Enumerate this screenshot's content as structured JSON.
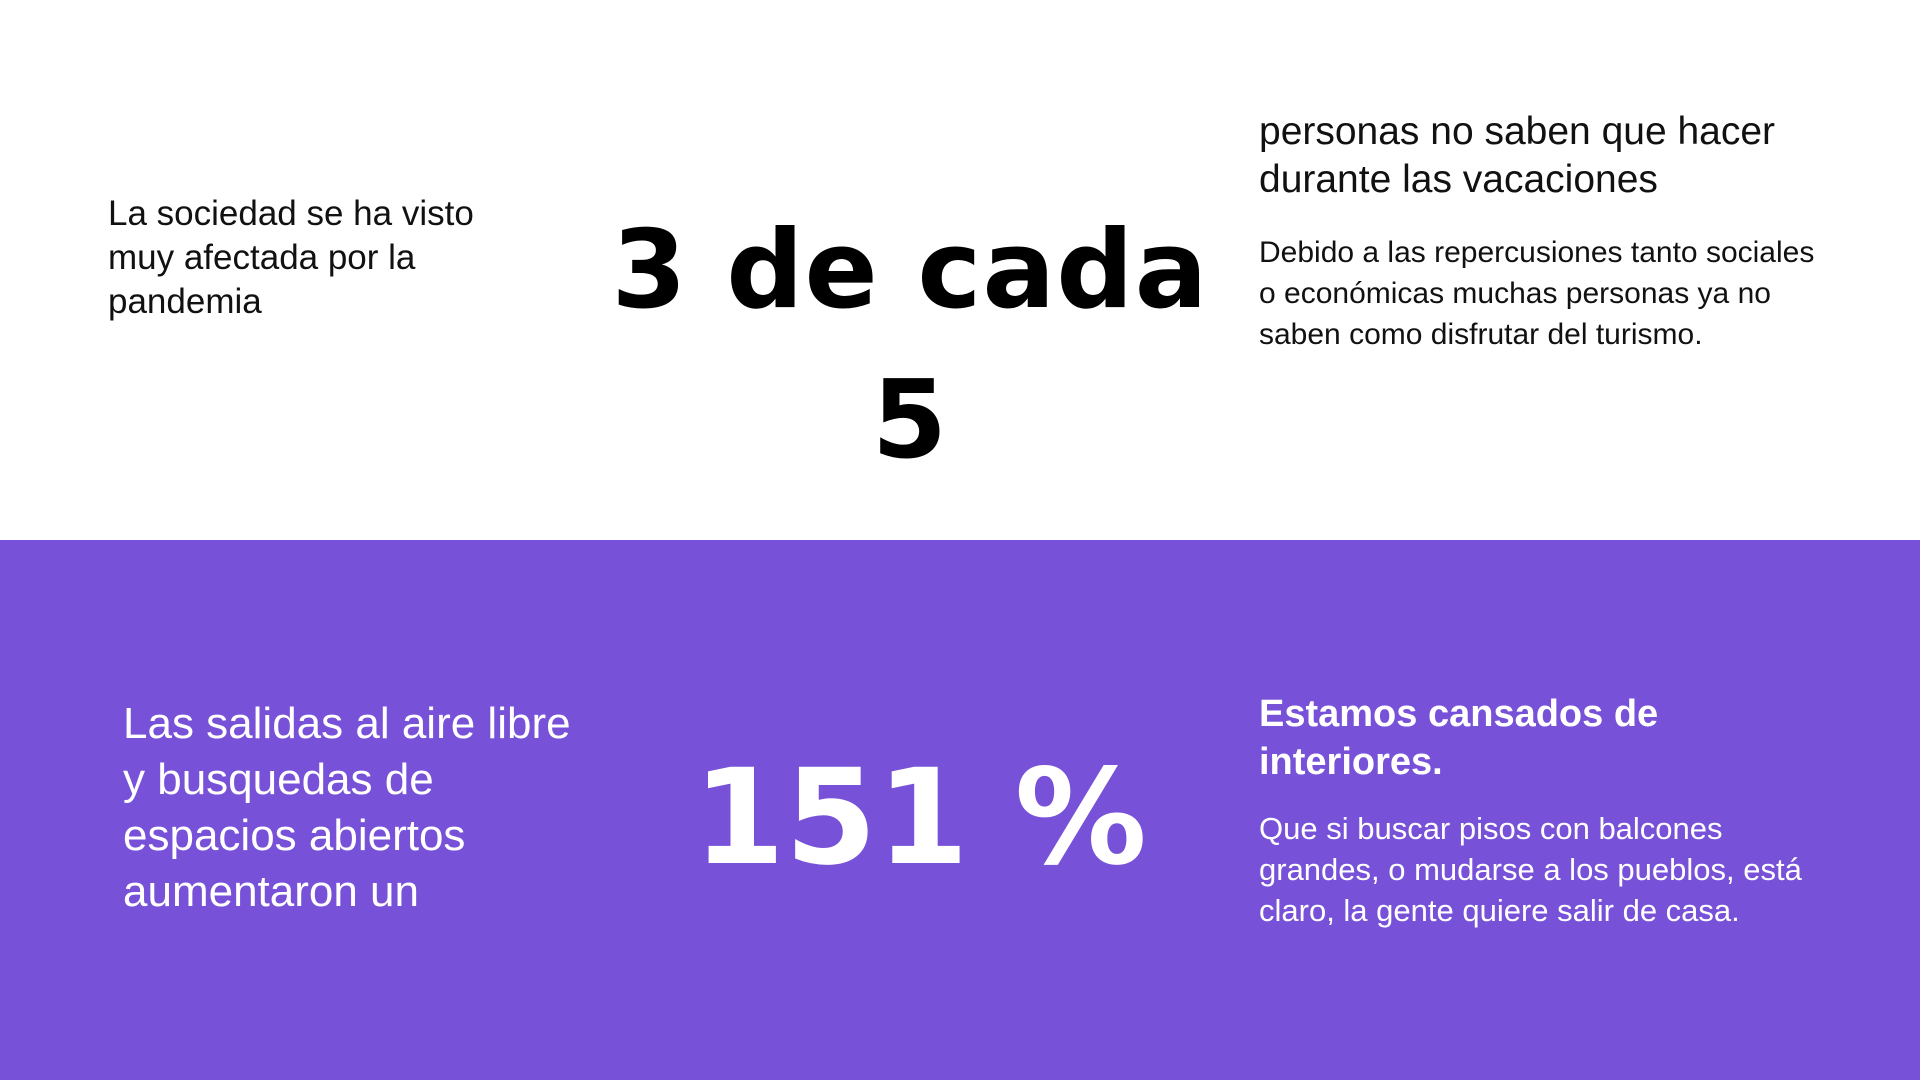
{
  "top": {
    "left_text": "La sociedad se ha visto muy afectada por la pandemia",
    "big_stat": "3 de cada 5",
    "right_heading": "personas no saben que hacer durante las vacaciones",
    "right_body": "Debido a las repercusiones tanto sociales o económicas muchas personas ya no saben como disfrutar del turismo."
  },
  "bottom": {
    "left_text": "Las salidas al aire libre y busquedas de espacios abiertos aumentaron un",
    "big_stat": "151 %",
    "right_heading": "Estamos cansados de interiores.",
    "right_body": "Que si buscar pisos con balcones grandes, o mudarse a los pueblos, está claro, la gente quiere salir de casa."
  },
  "colors": {
    "top_background": "#ffffff",
    "bottom_background": "#7851d9",
    "top_text": "#000000",
    "bottom_text": "#ffffff"
  }
}
